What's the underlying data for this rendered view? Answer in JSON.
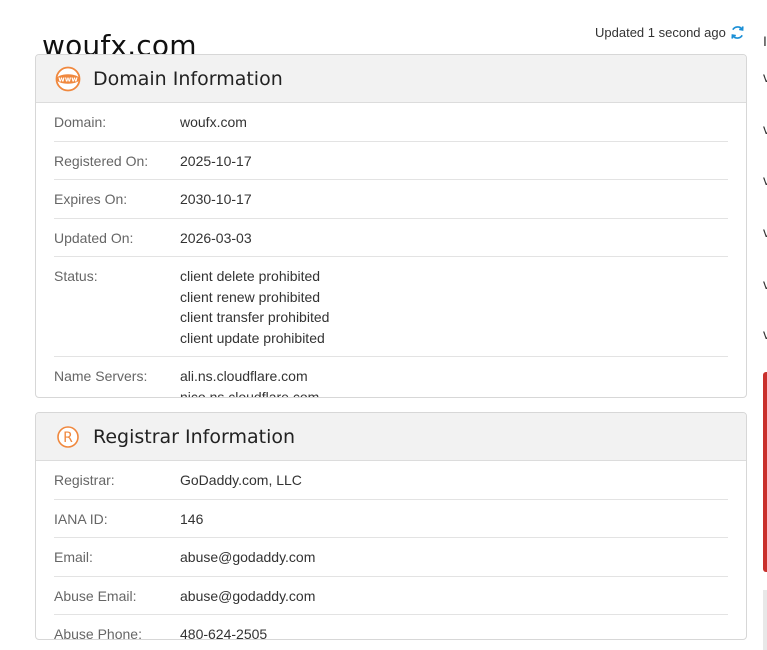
{
  "page": {
    "title": "woufx.com",
    "updated_text": "Updated 1 second ago"
  },
  "domain_info": {
    "title": "Domain Information",
    "icon": "www-globe-icon",
    "rows": [
      {
        "label": "Domain:",
        "values": [
          "woufx.com"
        ]
      },
      {
        "label": "Registered On:",
        "values": [
          "2025-10-17"
        ]
      },
      {
        "label": "Expires On:",
        "values": [
          "2030-10-17"
        ]
      },
      {
        "label": "Updated On:",
        "values": [
          "2026-03-03"
        ]
      },
      {
        "label": "Status:",
        "values": [
          "client delete prohibited",
          "client renew prohibited",
          "client transfer prohibited",
          "client update prohibited"
        ]
      },
      {
        "label": "Name Servers:",
        "values": [
          "ali.ns.cloudflare.com",
          "nico.ns.cloudflare.com"
        ]
      }
    ]
  },
  "registrar_info": {
    "title": "Registrar Information",
    "icon": "registered-mark-icon",
    "rows": [
      {
        "label": "Registrar:",
        "values": [
          "GoDaddy.com, LLC"
        ]
      },
      {
        "label": "IANA ID:",
        "values": [
          "146"
        ]
      },
      {
        "label": "Email:",
        "values": [
          "abuse@godaddy.com"
        ]
      },
      {
        "label": "Abuse Email:",
        "values": [
          "abuse@godaddy.com"
        ]
      },
      {
        "label": "Abuse Phone:",
        "values": [
          "480-624-2505"
        ]
      }
    ]
  },
  "sidebar": {
    "letters": [
      "I",
      "v",
      "v",
      "v",
      "v",
      "v",
      "v"
    ]
  },
  "colors": {
    "accent_orange": "#f0883e",
    "refresh_blue": "#1a8fd6",
    "sidebar_red": "#c9302c"
  }
}
